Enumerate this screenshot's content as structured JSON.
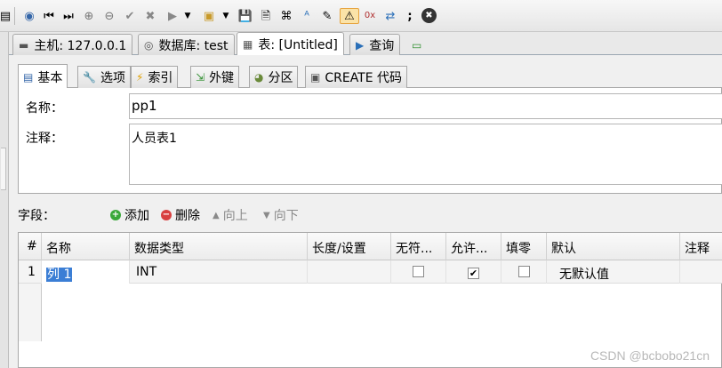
{
  "toolbar": {
    "icons": [
      "table-icon",
      "help-icon",
      "first-icon",
      "last-icon",
      "add-icon",
      "remove-icon",
      "check-icon",
      "cancel-icon",
      "play-icon",
      "play-dropdown-icon",
      "dialog-icon",
      "dialog-dropdown-icon",
      "save-icon",
      "save-as-icon",
      "binoculars-icon",
      "font-icon",
      "edit-icon",
      "warning-icon",
      "hex-icon",
      "transfer-icon",
      "semicolon-icon",
      "stop-icon"
    ]
  },
  "outer_tabs": [
    {
      "label": "主机: 127.0.0.1",
      "icon": "host-icon"
    },
    {
      "label": "数据库: test",
      "icon": "database-icon"
    },
    {
      "label": "表: [Untitled]",
      "icon": "table-icon",
      "active": true
    },
    {
      "label": "查询",
      "icon": "query-icon"
    },
    {
      "label": "",
      "icon": "new-tab-icon"
    }
  ],
  "inner_tabs": [
    {
      "label": "基本",
      "icon": "basic-icon",
      "active": true
    },
    {
      "label": "选项",
      "icon": "wrench-icon"
    },
    {
      "label": "索引",
      "icon": "lightning-icon"
    },
    {
      "label": "外键",
      "icon": "foreign-key-icon"
    },
    {
      "label": "分区",
      "icon": "partition-icon"
    },
    {
      "label": "CREATE 代码",
      "icon": "code-icon"
    }
  ],
  "form": {
    "name_label": "名称：",
    "name_value": "pp1",
    "comment_label": "注释：",
    "comment_value": "人员表1"
  },
  "fields_bar": {
    "label": "字段：",
    "add": "添加",
    "delete": "删除",
    "up": "向上",
    "down": "向下"
  },
  "grid": {
    "headers": [
      "#",
      "名称",
      "数据类型",
      "长度/设置",
      "无符...",
      "允许...",
      "填零",
      "默认",
      "注释"
    ],
    "rows": [
      {
        "num": "1",
        "name": "列 1",
        "type": "INT",
        "length": "",
        "unsigned": false,
        "nullable": true,
        "zerofill": false,
        "default": "无默认值",
        "comment": ""
      }
    ]
  },
  "watermark": "CSDN @bcbobo21cn"
}
